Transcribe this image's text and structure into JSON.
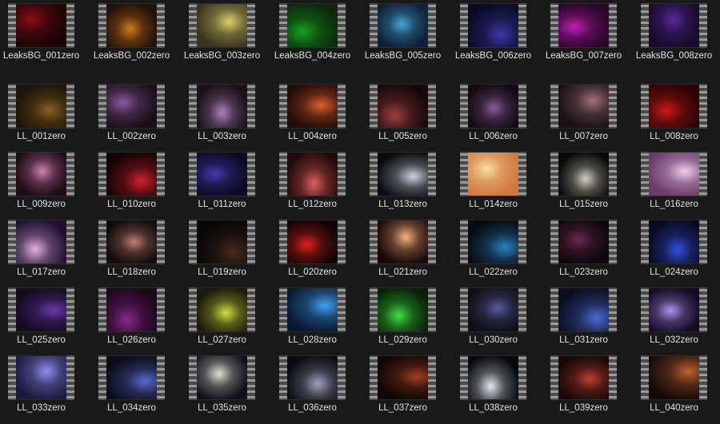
{
  "files": [
    {
      "name": "LeaksBG_001zero",
      "color": "#8a0d12",
      "bg": "#1a0405"
    },
    {
      "name": "LeaksBG_002zero",
      "color": "#d07a1a",
      "bg": "#24100a"
    },
    {
      "name": "LeaksBG_003zero",
      "color": "#dcd36a",
      "bg": "#3a3420"
    },
    {
      "name": "LeaksBG_004zero",
      "color": "#18a01e",
      "bg": "#0a2a0b"
    },
    {
      "name": "LeaksBG_005zero",
      "color": "#4aa6dc",
      "bg": "#0d2236"
    },
    {
      "name": "LeaksBG_006zero",
      "color": "#3a3aa8",
      "bg": "#0a0a26"
    },
    {
      "name": "LeaksBG_007zero",
      "color": "#c01eb6",
      "bg": "#2a062a"
    },
    {
      "name": "LeaksBG_008zero",
      "color": "#5a2aa0",
      "bg": "#180a2a"
    },
    {
      "name": "LL_001zero",
      "color": "#8a6020",
      "bg": "#1c1408"
    },
    {
      "name": "LL_002zero",
      "color": "#8a5aa0",
      "bg": "#1a0d18"
    },
    {
      "name": "LL_003zero",
      "color": "#b080c0",
      "bg": "#1a1018"
    },
    {
      "name": "LL_004zero",
      "color": "#e06030",
      "bg": "#240c08"
    },
    {
      "name": "LL_005zero",
      "color": "#a04040",
      "bg": "#160808"
    },
    {
      "name": "LL_006zero",
      "color": "#8a5a9a",
      "bg": "#140a14"
    },
    {
      "name": "LL_007zero",
      "color": "#a0707a",
      "bg": "#1a1014"
    },
    {
      "name": "LL_008zero",
      "color": "#d01818",
      "bg": "#2a0404"
    },
    {
      "name": "LL_009zero",
      "color": "#d080b0",
      "bg": "#1e0a16"
    },
    {
      "name": "LL_010zero",
      "color": "#d02030",
      "bg": "#140404"
    },
    {
      "name": "LL_011zero",
      "color": "#4a3ab0",
      "bg": "#0c0a24"
    },
    {
      "name": "LL_012zero",
      "color": "#e06060",
      "bg": "#240a0a"
    },
    {
      "name": "LL_013zero",
      "color": "#d0d0e0",
      "bg": "#0a0a10"
    },
    {
      "name": "LL_014zero",
      "color": "#f8e0a0",
      "bg": "#d07840"
    },
    {
      "name": "LL_015zero",
      "color": "#d0d0c0",
      "bg": "#080808"
    },
    {
      "name": "LL_016zero",
      "color": "#f0d0f0",
      "bg": "#6a3a6a"
    },
    {
      "name": "LL_017zero",
      "color": "#e0b0e0",
      "bg": "#201030"
    },
    {
      "name": "LL_018zero",
      "color": "#c08070",
      "bg": "#140c0c"
    },
    {
      "name": "LL_019zero",
      "color": "#4a2a20",
      "bg": "#080606"
    },
    {
      "name": "LL_020zero",
      "color": "#e02020",
      "bg": "#100404"
    },
    {
      "name": "LL_021zero",
      "color": "#f8b080",
      "bg": "#1a0808"
    },
    {
      "name": "LL_022zero",
      "color": "#2a80c0",
      "bg": "#060a12"
    },
    {
      "name": "LL_023zero",
      "color": "#6a2a50",
      "bg": "#0e060c"
    },
    {
      "name": "LL_024zero",
      "color": "#3050e0",
      "bg": "#080a20"
    },
    {
      "name": "LL_025zero",
      "color": "#6a3ab0",
      "bg": "#140a20"
    },
    {
      "name": "LL_026zero",
      "color": "#8a2a8a",
      "bg": "#1e061e"
    },
    {
      "name": "LL_027zero",
      "color": "#d0e040",
      "bg": "#1a1a08"
    },
    {
      "name": "LL_028zero",
      "color": "#40a0f0",
      "bg": "#081830"
    },
    {
      "name": "LL_029zero",
      "color": "#40e040",
      "bg": "#082008"
    },
    {
      "name": "LL_030zero",
      "color": "#5a5a9a",
      "bg": "#0e0e18"
    },
    {
      "name": "LL_031zero",
      "color": "#4a6ad0",
      "bg": "#0a0e20"
    },
    {
      "name": "LL_032zero",
      "color": "#b090f0",
      "bg": "#140a24"
    },
    {
      "name": "LL_033zero",
      "color": "#9090f0",
      "bg": "#1a1a40"
    },
    {
      "name": "LL_034zero",
      "color": "#5a6ad0",
      "bg": "#0a0c18"
    },
    {
      "name": "LL_035zero",
      "color": "#e0e0d0",
      "bg": "#10101a"
    },
    {
      "name": "LL_036zero",
      "color": "#a0a0c0",
      "bg": "#0a0a10"
    },
    {
      "name": "LL_037zero",
      "color": "#a04020",
      "bg": "#100604"
    },
    {
      "name": "LL_038zero",
      "color": "#e0e8f0",
      "bg": "#06080e"
    },
    {
      "name": "LL_039zero",
      "color": "#c04030",
      "bg": "#180808"
    },
    {
      "name": "LL_040zero",
      "color": "#c06030",
      "bg": "#140a08"
    }
  ]
}
